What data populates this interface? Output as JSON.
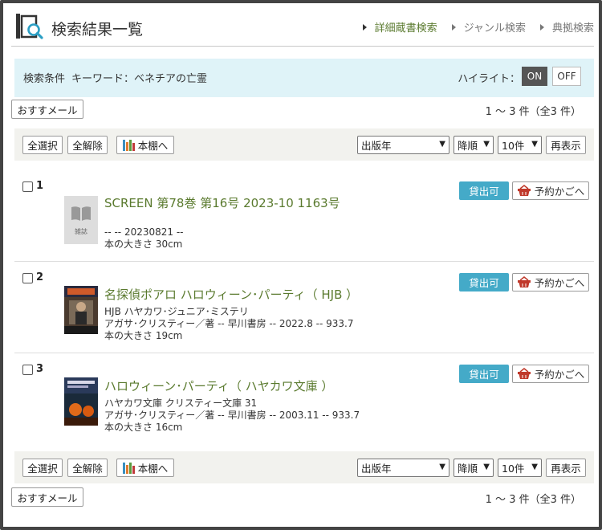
{
  "header": {
    "title": "検索結果一覧",
    "nav": [
      {
        "label": "詳細蔵書検索"
      },
      {
        "label": "ジャンル検索"
      },
      {
        "label": "典拠検索"
      }
    ]
  },
  "condition": {
    "label": "検索条件",
    "keyword": "キーワード：ベネチアの亡霊",
    "highlight_label": "ハイライト：",
    "on": "ON",
    "off": "OFF"
  },
  "top_bar": {
    "recommend": "おすすメール",
    "count": "1 ～ 3 件（全3 件）"
  },
  "toolbar": {
    "select_all": "全選択",
    "deselect_all": "全解除",
    "to_shelf": "本棚へ",
    "sort_field": "出版年",
    "sort_order": "降順",
    "per_page": "10件",
    "redisplay": "再表示"
  },
  "bottom_bar": {
    "recommend": "おすすメール",
    "count": "1 ～ 3 件（全3 件）"
  },
  "results": [
    {
      "num": "1",
      "title": "SCREEN 第78巻 第16号 2023-10 1163号",
      "lines": [
        "",
        "-- -- 20230821 --",
        "本の大きさ 30cm"
      ],
      "thumb_label": "雑誌",
      "status": "貸出可",
      "cart": "予約かごへ"
    },
    {
      "num": "2",
      "title": "名探偵ポアロ ハロウィーン･パーティ（ HJB ）",
      "lines": [
        "HJB ハヤカワ･ジュニア･ミステリ",
        "アガサ･クリスティー／著 -- 早川書房 -- 2022.8 -- 933.7",
        "本の大きさ 19cm"
      ],
      "status": "貸出可",
      "cart": "予約かごへ"
    },
    {
      "num": "3",
      "title": "ハロウィーン･パーティ（ ハヤカワ文庫 ）",
      "lines": [
        "ハヤカワ文庫 クリスティー文庫 31",
        "アガサ･クリスティー／著 -- 早川書房 -- 2003.11 -- 933.7",
        "本の大きさ 16cm"
      ],
      "status": "貸出可",
      "cart": "予約かごへ"
    }
  ],
  "colors": {
    "accent_green": "#5a7a2e",
    "condition_bg": "#dff3f8",
    "available_blue": "#44aac8"
  }
}
